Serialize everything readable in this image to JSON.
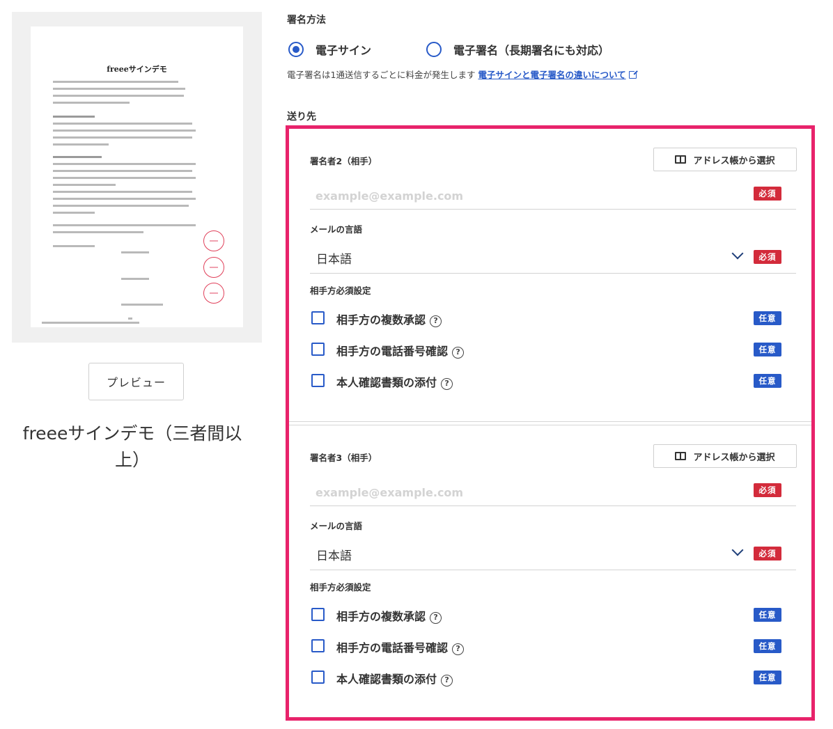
{
  "preview": {
    "document_title": "freeeサインデモ",
    "button_label": "プレビュー",
    "document_name": "freeeサインデモ（三者間以上）"
  },
  "signing_method": {
    "heading": "署名方法",
    "options": [
      {
        "label": "電子サイン",
        "selected": true
      },
      {
        "label": "電子署名（長期署名にも対応）",
        "selected": false
      }
    ],
    "note": "電子署名は1通送信するごとに料金が発生します",
    "link": "電子サインと電子署名の違いについて"
  },
  "recipients": {
    "heading": "送り先",
    "signers": [
      {
        "label": "署名者2（相手）",
        "address_book_button": "アドレス帳から選択",
        "email_placeholder": "example@example.com",
        "email_badge": "必須",
        "language_label": "メールの言語",
        "language_value": "日本語",
        "language_badge": "必須",
        "required_settings_label": "相手方必須設定",
        "options": [
          {
            "label": "相手方の複数承認",
            "badge": "任意"
          },
          {
            "label": "相手方の電話番号確認",
            "badge": "任意"
          },
          {
            "label": "本人確認書類の添付",
            "badge": "任意"
          }
        ]
      },
      {
        "label": "署名者3（相手）",
        "address_book_button": "アドレス帳から選択",
        "email_placeholder": "example@example.com",
        "email_badge": "必須",
        "language_label": "メールの言語",
        "language_value": "日本語",
        "language_badge": "必須",
        "required_settings_label": "相手方必須設定",
        "options": [
          {
            "label": "相手方の複数承認",
            "badge": "任意"
          },
          {
            "label": "相手方の電話番号確認",
            "badge": "任意"
          },
          {
            "label": "本人確認書類の添付",
            "badge": "任意"
          }
        ]
      }
    ]
  },
  "colors": {
    "accent": "#285ac8",
    "required": "#d32b3b",
    "highlight_border": "#e8236b"
  }
}
